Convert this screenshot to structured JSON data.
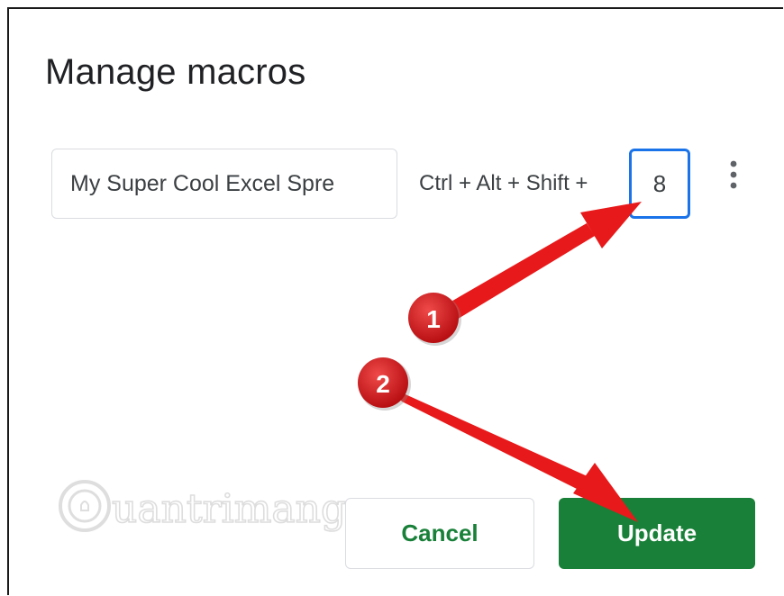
{
  "dialog": {
    "title": "Manage macros",
    "macro_name_value": "My Super Cool Excel Spre",
    "shortcut_prefix": "Ctrl + Alt + Shift +",
    "shortcut_key_value": "8",
    "more_icon": "more-vert-icon",
    "cancel_label": "Cancel",
    "update_label": "Update"
  },
  "annotations": {
    "step1": "1",
    "step2": "2",
    "arrow_color": "#e8191a"
  },
  "watermark": {
    "text": "uantrimang"
  },
  "colors": {
    "accent_green": "#188038",
    "focus_blue": "#1a73e8"
  }
}
